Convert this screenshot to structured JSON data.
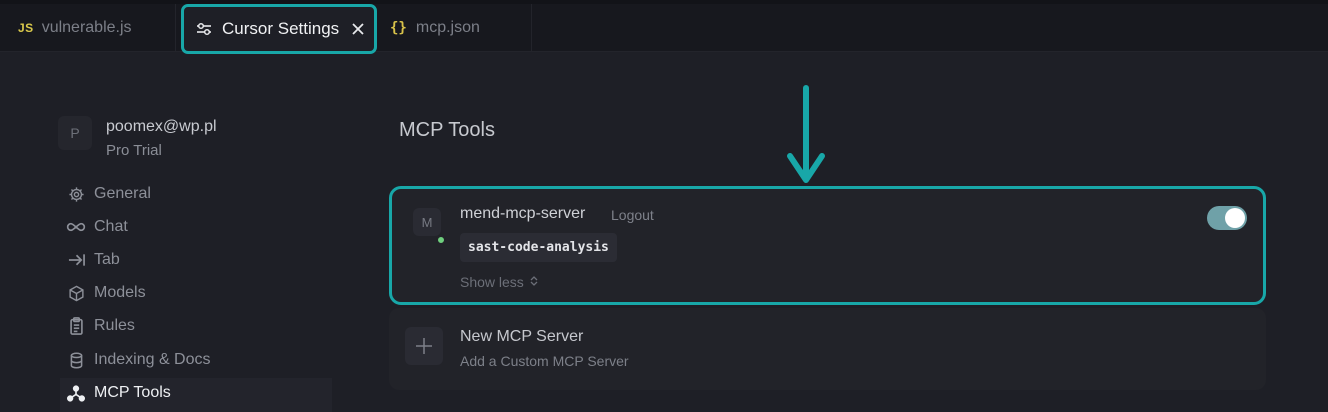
{
  "tabs": [
    {
      "icon": "js-file-icon",
      "icon_text": "JS",
      "label": "vulnerable.js"
    },
    {
      "icon": "sliders-icon",
      "label": "Cursor Settings",
      "active": true
    },
    {
      "icon": "json-braces-icon",
      "icon_text": "{}",
      "label": "mcp.json"
    }
  ],
  "user": {
    "avatar_initial": "P",
    "email": "poomex@wp.pl",
    "plan": "Pro Trial"
  },
  "sidebar": {
    "items": [
      {
        "label": "General",
        "icon": "gear-icon"
      },
      {
        "label": "Chat",
        "icon": "infinity-icon"
      },
      {
        "label": "Tab",
        "icon": "tab-arrow-icon"
      },
      {
        "label": "Models",
        "icon": "cube-icon"
      },
      {
        "label": "Rules",
        "icon": "clipboard-icon"
      },
      {
        "label": "Indexing & Docs",
        "icon": "database-icon"
      },
      {
        "label": "MCP Tools",
        "icon": "mcp-nodes-icon",
        "active": true
      }
    ]
  },
  "main": {
    "title": "MCP Tools",
    "server": {
      "avatar_initial": "M",
      "name": "mend-mcp-server",
      "logout_label": "Logout",
      "tool": "sast-code-analysis",
      "show_less_label": "Show less",
      "enabled": true,
      "status_color": "#6fcf7e"
    },
    "new_server": {
      "title": "New MCP Server",
      "subtitle": "Add a Custom MCP Server"
    }
  },
  "colors": {
    "highlight": "#18a7a8",
    "background": "#1e1f26",
    "tabbar": "#17181e"
  }
}
